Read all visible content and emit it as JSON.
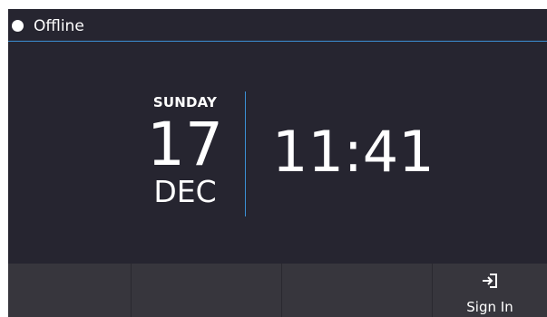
{
  "status": {
    "label": "Offline",
    "indicator_color": "#ffffff"
  },
  "clock": {
    "day_name": "SUNDAY",
    "day_number": "17",
    "month": "DEC",
    "time": "11:41"
  },
  "softkeys": [
    {
      "label": "",
      "icon": ""
    },
    {
      "label": "",
      "icon": ""
    },
    {
      "label": "",
      "icon": ""
    },
    {
      "label": "Sign In",
      "icon": "sign-in-icon"
    }
  ],
  "colors": {
    "background": "#262530",
    "accent": "#3b8fd4",
    "softkey_bar": "#37363d"
  }
}
